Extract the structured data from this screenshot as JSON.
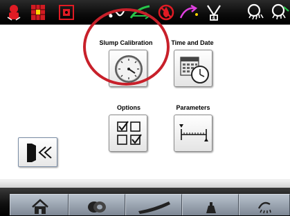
{
  "status_bar": {
    "icons": [
      "alarm-bell-icon",
      "grid-fault-icon",
      "truck-lock-icon",
      "drum-rotation-icon",
      "slump-curve-icon",
      "no-water-icon",
      "additive-icon",
      "water-meter-icon",
      "washout-icon",
      "washout-alt-icon"
    ]
  },
  "menu": {
    "items": [
      {
        "label": "Slump Calibration",
        "icon": "gauge-icon"
      },
      {
        "label": "Time and Date",
        "icon": "calendar-clock-icon"
      },
      {
        "label": "Options",
        "icon": "checkbox-grid-icon"
      },
      {
        "label": "Parameters",
        "icon": "ruler-scale-icon"
      }
    ],
    "highlighted_item": "Slump Calibration",
    "highlight_color": "#c8202a"
  },
  "exit": {
    "icon": "exit-door-icon"
  },
  "nav_bar": {
    "buttons": [
      "home-icon",
      "drum-icon",
      "chute-icon",
      "weight-icon",
      "washout-icon"
    ]
  }
}
